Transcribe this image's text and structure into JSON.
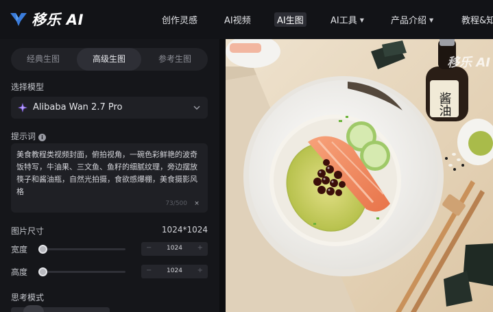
{
  "brand": {
    "name": "移乐 AI"
  },
  "nav": {
    "items": [
      {
        "label": "创作灵感",
        "has_caret": false,
        "active": false
      },
      {
        "label": "AI视频",
        "has_caret": false,
        "active": false
      },
      {
        "label": "AI生图",
        "has_caret": false,
        "active": true
      },
      {
        "label": "AI工具",
        "has_caret": true,
        "active": false
      },
      {
        "label": "产品介绍",
        "has_caret": true,
        "active": false
      },
      {
        "label": "教程&知",
        "has_caret": false,
        "active": false
      }
    ]
  },
  "mode_tabs": [
    {
      "label": "经典生图",
      "active": false
    },
    {
      "label": "高级生图",
      "active": true
    },
    {
      "label": "参考生图",
      "active": false
    }
  ],
  "model": {
    "section_label": "选择模型",
    "selected": "Alibaba Wan 2.7 Pro",
    "icon": "sparkle-icon"
  },
  "prompt": {
    "section_label": "提示词",
    "text": "美食教程类视频封面，俯拍视角，一碗色彩鲜艳的波奇饭特写，牛油果、三文鱼、鱼籽的细腻纹理，旁边摆放筷子和酱油瓶，自然光拍摄，食欲感爆棚，美食摄影风格",
    "counter": "73/500",
    "clear_symbol": "×"
  },
  "image_size": {
    "section_label": "图片尺寸",
    "value": "1024*1024",
    "width": {
      "label": "宽度",
      "value": "1024",
      "level": 0.0
    },
    "height": {
      "label": "高度",
      "value": "1024",
      "level": 0.0
    },
    "minus": "−",
    "plus": "+"
  },
  "thinking_mode": {
    "section_label": "思考模式"
  },
  "preview": {
    "watermark": "移乐 AI",
    "bottle_label": "酱油"
  },
  "colors": {
    "brand_blue": "#3b7ddd",
    "panel_bg": "#15161a",
    "input_bg": "#1f2025"
  }
}
